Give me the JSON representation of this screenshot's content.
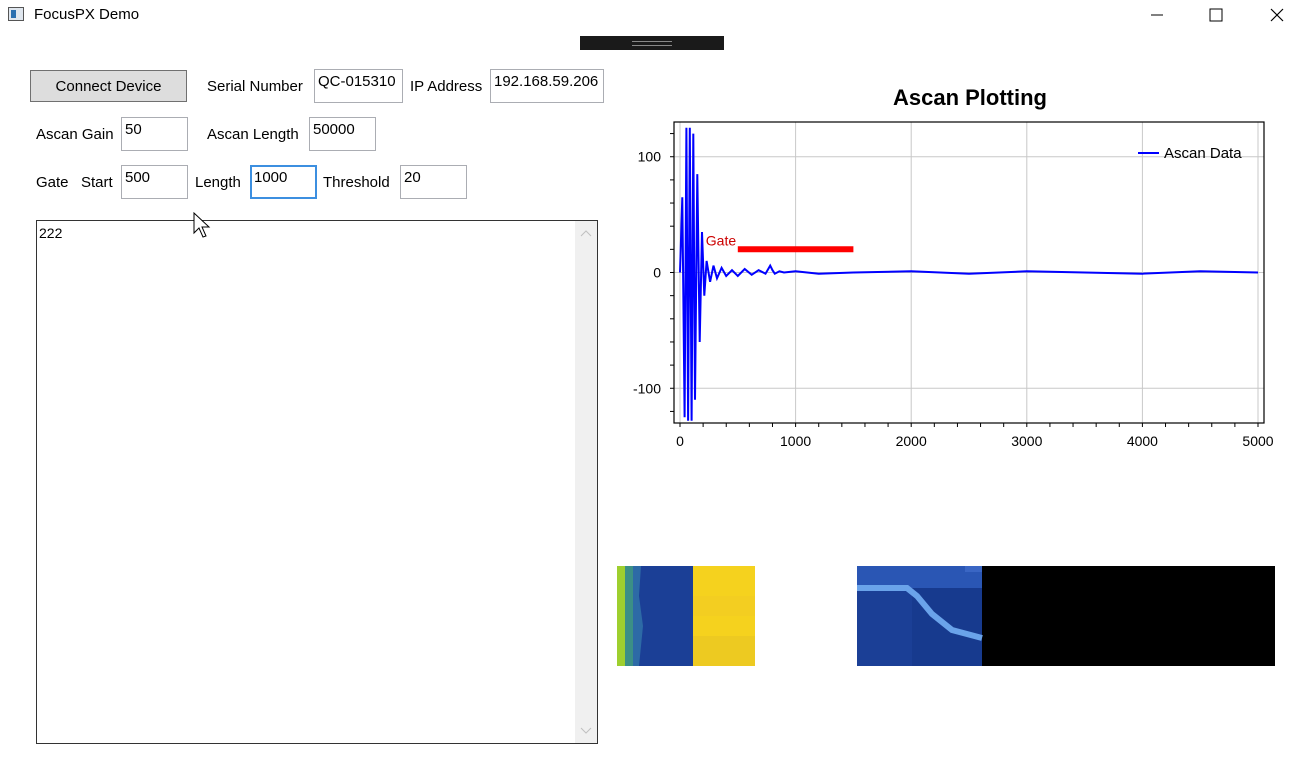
{
  "window": {
    "title": "FocusPX Demo"
  },
  "toolbar": {
    "connect_label": "Connect Device",
    "serial_label": "Serial Number",
    "serial_value": "QC-015310",
    "ip_label": "IP Address",
    "ip_value": "192.168.59.206",
    "gain_label": "Ascan Gain",
    "gain_value": "50",
    "length_label": "Ascan Length",
    "length_value": "50000",
    "gate_label": "Gate",
    "gate_start_label": "Start",
    "gate_start_value": "500",
    "gate_length_label": "Length",
    "gate_length_value": "1000",
    "threshold_label": "Threshold",
    "threshold_value": "20"
  },
  "log": {
    "text": "222"
  },
  "chart_data": {
    "type": "line",
    "title": "Ascan Plotting",
    "xlim": [
      0,
      5000
    ],
    "ylim": [
      -130,
      130
    ],
    "xticks": [
      "0",
      "1000",
      "2000",
      "3000",
      "4000",
      "5000"
    ],
    "yticks": [
      "100",
      "0",
      "-100"
    ],
    "grid": true,
    "legend_position": "top-right",
    "series": [
      {
        "name": "Ascan Data",
        "color": "#0000ff",
        "x": [
          0,
          20,
          40,
          55,
          70,
          85,
          100,
          115,
          130,
          150,
          170,
          190,
          210,
          230,
          260,
          290,
          320,
          360,
          400,
          450,
          500,
          560,
          620,
          680,
          740,
          780,
          800,
          820,
          860,
          900,
          1000,
          1200,
          1500,
          2000,
          2500,
          3000,
          3500,
          4000,
          4500,
          5000
        ],
        "y": [
          0,
          65,
          -125,
          125,
          -128,
          125,
          -128,
          120,
          -110,
          85,
          -60,
          35,
          -20,
          10,
          -8,
          6,
          -5,
          4,
          -3,
          2,
          -3,
          3,
          -2,
          2,
          -1,
          6,
          2,
          -1,
          1,
          0,
          1,
          -1,
          0,
          1,
          -1,
          1,
          0,
          -1,
          1,
          0
        ]
      },
      {
        "name": "Gate",
        "color": "#ff0000",
        "x": [
          500,
          1500
        ],
        "y": [
          20,
          20
        ]
      }
    ],
    "annotation": "Gate"
  },
  "colors": {
    "accent_focus": "#3c8fe0",
    "signal": "#0000ff",
    "gate": "#ff0000",
    "cscan_blue": "#1b3f96",
    "cscan_yellow": "#f5d21e"
  }
}
